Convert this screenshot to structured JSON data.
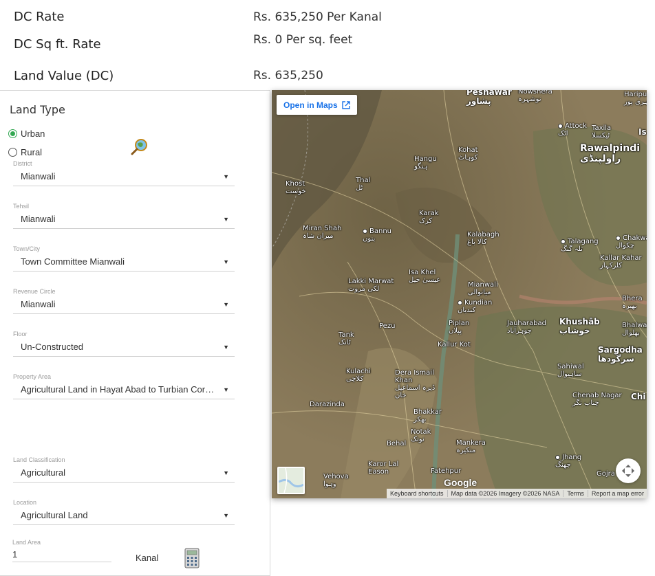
{
  "rates": {
    "dc_rate_label": "DC Rate",
    "dc_rate_value": "Rs. 635,250 Per Kanal",
    "dc_sqft_label": "DC Sq ft. Rate",
    "dc_sqft_value": "Rs. 0 Per sq. feet",
    "land_value_label": "Land Value (DC)",
    "land_value_value": "Rs. 635,250"
  },
  "land_type": {
    "title": "Land Type",
    "options": [
      {
        "label": "Urban",
        "checked": true
      },
      {
        "label": "Rural",
        "checked": false
      }
    ]
  },
  "fields": {
    "district": {
      "label": "District",
      "value": "Mianwali"
    },
    "tehsil": {
      "label": "Tehsil",
      "value": "Mianwali"
    },
    "town": {
      "label": "Town/City",
      "value": "Town Committee Mianwali"
    },
    "revenue_circle": {
      "label": "Revenue Circle",
      "value": "Mianwali"
    },
    "floor": {
      "label": "Floor",
      "value": "Un-Constructed"
    },
    "property_area": {
      "label": "Property Area",
      "value": "Agricultural Land in Hayat Abad to Turbian Cornel Gharbi and Ali Khel Gharbi"
    },
    "land_classification": {
      "label": "Land Classification",
      "value": "Agricultural"
    },
    "location": {
      "label": "Location",
      "value": "Agricultural Land"
    },
    "land_area": {
      "label": "Land Area",
      "value": "1",
      "unit": "Kanal"
    }
  },
  "map": {
    "open_in_maps": "Open in Maps",
    "google": "Google",
    "attribution": [
      "Keyboard shortcuts",
      "Map data ©2026 Imagery ©2026 NASA",
      "Terms",
      "Report a map error"
    ],
    "cities": [
      {
        "en": "Peshawar",
        "ur": "پشاور"
      },
      {
        "en": "Nowshera",
        "ur": "نوشہرہ"
      },
      {
        "en": "Haripur",
        "ur": "ہری پور"
      },
      {
        "en": "Attock",
        "ur": "اٹک"
      },
      {
        "en": "Taxila",
        "ur": "ٹیکسلا"
      },
      {
        "en": "Is",
        "ur": ""
      },
      {
        "en": "Rawalpindi",
        "ur": "راولپنڈی"
      },
      {
        "en": "Kohat",
        "ur": "کوہاٹ"
      },
      {
        "en": "Hangu",
        "ur": "ہنگو"
      },
      {
        "en": "Thal",
        "ur": "ٹل"
      },
      {
        "en": "Khost",
        "ur": "خوست"
      },
      {
        "en": "Karak",
        "ur": "کرک"
      },
      {
        "en": "Miran Shah",
        "ur": "میران شاہ"
      },
      {
        "en": "Bannu",
        "ur": "بنوں"
      },
      {
        "en": "Kalabagh",
        "ur": "کالا باغ"
      },
      {
        "en": "Talagang",
        "ur": "تلہ گنگ"
      },
      {
        "en": "Chakwal",
        "ur": "چکوال"
      },
      {
        "en": "Kallar Kahar",
        "ur": "کلرکہار"
      },
      {
        "en": "Isa Khel",
        "ur": "عیسیٰ خیل"
      },
      {
        "en": "Lakki Marwat",
        "ur": "لکی مروت"
      },
      {
        "en": "Mianwali",
        "ur": "میانوالی"
      },
      {
        "en": "Kundian",
        "ur": "کندیاں"
      },
      {
        "en": "Bhera",
        "ur": "بھیرہ"
      },
      {
        "en": "Piplan",
        "ur": "پپلاں"
      },
      {
        "en": "Jauharabad",
        "ur": "جوہرآباد"
      },
      {
        "en": "Khushāb",
        "ur": "خوشاب"
      },
      {
        "en": "Bhalwal",
        "ur": "بھلوال"
      },
      {
        "en": "Pezu",
        "ur": ""
      },
      {
        "en": "Tank",
        "ur": "ٹانک"
      },
      {
        "en": "Kallur Kot",
        "ur": ""
      },
      {
        "en": "Sargodha",
        "ur": "سرگودھا"
      },
      {
        "en": "Sahiwal",
        "ur": "ساہیوال"
      },
      {
        "en": "Kulachi",
        "ur": "کلاچی"
      },
      {
        "en": "Dera Ismail Khan",
        "ur": "ڈیرہ اسماعیل خان"
      },
      {
        "en": "Chenab Nagar",
        "ur": "چناب نگر"
      },
      {
        "en": "Chi",
        "ur": ""
      },
      {
        "en": "Darazinda",
        "ur": ""
      },
      {
        "en": "Bhakkar",
        "ur": "بھکر"
      },
      {
        "en": "Notak",
        "ur": "نوتک"
      },
      {
        "en": "Behal",
        "ur": ""
      },
      {
        "en": "Mankera",
        "ur": "منکیرہ"
      },
      {
        "en": "Jhang",
        "ur": "جھنگ"
      },
      {
        "en": "Karor Lal Eason",
        "ur": ""
      },
      {
        "en": "Fatehpur",
        "ur": ""
      },
      {
        "en": "Vehova",
        "ur": "وہوا"
      },
      {
        "en": "Gojra",
        "ur": ""
      }
    ]
  }
}
